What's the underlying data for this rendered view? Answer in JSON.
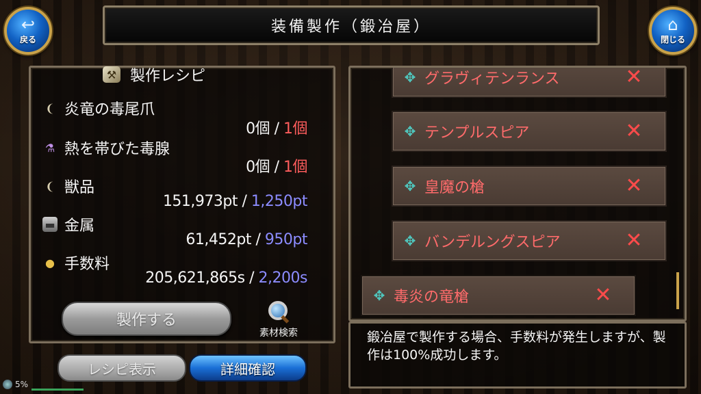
{
  "header": {
    "title": "装備製作（鍛冶屋）",
    "back_label": "戻る",
    "close_label": "閉じる"
  },
  "recipe": {
    "title": "製作レシピ",
    "materials": [
      {
        "name": "炎竜の毒尾爪",
        "icon": "claw-icon",
        "owned": "0個",
        "sep": " / ",
        "required": "1個"
      },
      {
        "name": "熱を帯びた毒腺",
        "icon": "flask-icon",
        "owned": "0個",
        "sep": " / ",
        "required": "1個"
      },
      {
        "name": "獣品",
        "icon": "claw-icon",
        "owned": "151,973pt",
        "sep": " / ",
        "required": "1,250pt"
      },
      {
        "name": "金属",
        "icon": "metal-icon",
        "owned": "61,452pt",
        "sep": " / ",
        "required": "950pt"
      },
      {
        "name": "手数料",
        "icon": "coin-icon",
        "owned": "205,621,865s",
        "sep": " / ",
        "required": "2,200s"
      }
    ],
    "craft_label": "製作する",
    "search_label": "素材検索",
    "recipe_view_label": "レシピ表示",
    "detail_label": "詳細確認"
  },
  "weapon_list": [
    {
      "name": "グラヴィテンランス",
      "mark": "✕"
    },
    {
      "name": "テンプルスピア",
      "mark": "✕"
    },
    {
      "name": "皇魔の槍",
      "mark": "✕"
    },
    {
      "name": "バンデルングスピア",
      "mark": "✕"
    },
    {
      "name": "毒炎の竜槍",
      "mark": "✕"
    }
  ],
  "description": "鍛冶屋で製作する場合、手数料が発生しますが、製作は100%成功します。",
  "status": {
    "percent": "5%"
  },
  "colors": {
    "required_red": "#ff5d5d",
    "required_blue": "#8c8cff",
    "item_name": "#ff6b6b",
    "accent_blue": "#1a6fd6"
  }
}
